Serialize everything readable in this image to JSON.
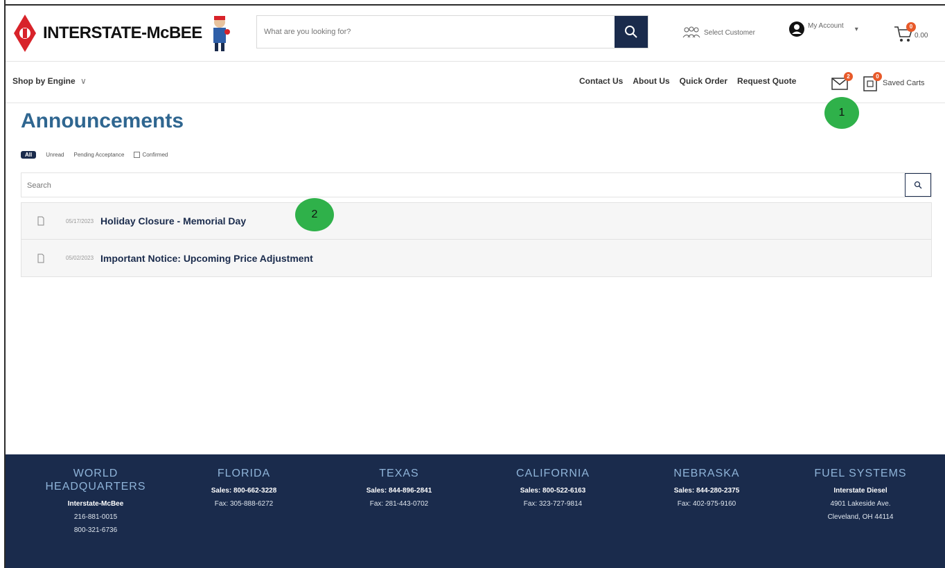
{
  "header": {
    "logo_text": "INTERSTATE-McBEE",
    "search_placeholder": "What are you looking for?",
    "select_customer": "Select Customer",
    "my_account": "My Account",
    "cart_count": "0",
    "cart_total": "0.00"
  },
  "nav": {
    "shop_by_engine": "Shop by Engine",
    "links": [
      "Contact Us",
      "About Us",
      "Quick Order",
      "Request Quote"
    ],
    "mail_badge": "2",
    "saved_carts_badge": "0",
    "saved_carts": "Saved Carts"
  },
  "callouts": {
    "one": "1",
    "two": "2"
  },
  "main": {
    "title": "Announcements",
    "filters": {
      "all": "All",
      "unread": "Unread",
      "pending": "Pending Acceptance",
      "confirmed": "Confirmed"
    },
    "search_placeholder": "Search",
    "announcements": [
      {
        "date": "05/17/2023",
        "title": "Holiday Closure - Memorial Day"
      },
      {
        "date": "05/02/2023",
        "title": "Important Notice: Upcoming Price Adjustment"
      }
    ]
  },
  "footer": {
    "columns": [
      {
        "heading": "WORLD HEADQUARTERS",
        "lines": [
          "Interstate-McBee",
          "216-881-0015",
          "800-321-6736"
        ]
      },
      {
        "heading": "FLORIDA",
        "lines": [
          "Sales: 800-662-3228",
          "Fax: 305-888-6272"
        ]
      },
      {
        "heading": "TEXAS",
        "lines": [
          "Sales: 844-896-2841",
          "Fax: 281-443-0702"
        ]
      },
      {
        "heading": "CALIFORNIA",
        "lines": [
          "Sales: 800-522-6163",
          "Fax: 323-727-9814"
        ]
      },
      {
        "heading": "NEBRASKA",
        "lines": [
          "Sales: 844-280-2375",
          "Fax: 402-975-9160"
        ]
      },
      {
        "heading": "FUEL SYSTEMS",
        "lines": [
          "Interstate Diesel",
          "4901 Lakeside Ave.",
          "Cleveland, OH 44114"
        ]
      }
    ]
  },
  "colors": {
    "navy": "#1a2b4c",
    "accent": "#2f6690",
    "badge": "#e85a2a",
    "callout": "#2fb14a",
    "logo_red": "#d8232a"
  }
}
